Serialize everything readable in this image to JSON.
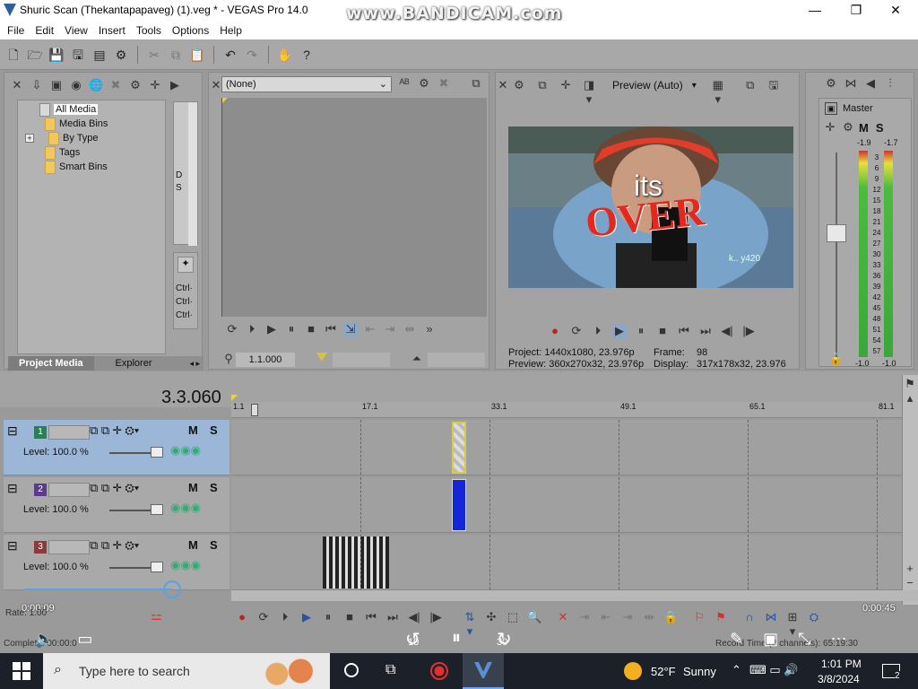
{
  "window": {
    "title": "Shuric Scan (Thekantapapaveg) (1).veg * - VEGAS Pro 14.0",
    "watermark": "www.BANDICAM.com",
    "minimize": "—",
    "maximize": "❐",
    "close": "✕"
  },
  "menu": [
    "File",
    "Edit",
    "View",
    "Insert",
    "Tools",
    "Options",
    "Help"
  ],
  "project_media": {
    "tree": [
      "All Media",
      "Media Bins",
      "By Type",
      "Tags",
      "Smart Bins"
    ],
    "expand": "+",
    "tabs": [
      "Project Media",
      "Explorer"
    ],
    "side_labels": [
      "Ctrl·",
      "Ctrl·",
      "Ctrl·"
    ],
    "side_top": [
      "D",
      "S"
    ]
  },
  "trimmer": {
    "select_value": "(None)",
    "time": "1.1.000"
  },
  "preview": {
    "mode": "Preview (Auto)",
    "overlay_text_1": "its",
    "overlay_text_2": "OVER",
    "overlay_small": "k.. y420",
    "info": {
      "project_label": "Project:",
      "project_value": "1440x1080, 23.976p",
      "preview_label": "Preview:",
      "preview_value": "360x270x32, 23.976p",
      "frame_label": "Frame:",
      "frame_value": "98",
      "display_label": "Display:",
      "display_value": "317x178x32, 23.976"
    }
  },
  "master": {
    "title": "Master",
    "m": "M",
    "s": "S",
    "peak_left": "-1.9",
    "peak_right": "-1.7",
    "scale": [
      "3",
      "6",
      "9",
      "12",
      "15",
      "18",
      "21",
      "24",
      "27",
      "30",
      "33",
      "36",
      "39",
      "42",
      "45",
      "48",
      "51",
      "54",
      "57"
    ],
    "bottom_left": "-1.0",
    "bottom_right": "-1.0"
  },
  "timeline": {
    "time": "3.3.060",
    "ruler": [
      "1.1",
      "17.1",
      "33.1",
      "49.1",
      "65.1",
      "81.1"
    ],
    "tracks": [
      {
        "num": "1",
        "level": "Level: 100.0 %",
        "m": "M",
        "s": "S"
      },
      {
        "num": "2",
        "level": "Level: 100.0 %",
        "m": "M",
        "s": "S"
      },
      {
        "num": "3",
        "level": "Level: 100.0 %",
        "m": "M",
        "s": "S"
      }
    ],
    "rate": "Rate: 1.00",
    "complete": "Complete: 00:00:0",
    "record_time": "Record Time (2 channels): 65:19:30"
  },
  "player": {
    "current": "0:00:09",
    "total": "0:00:45",
    "progress": 0.2,
    "skip_back": "10",
    "skip_fwd": "30"
  },
  "taskbar": {
    "search_placeholder": "Type here to search",
    "temp": "52°F",
    "weather": "Sunny",
    "time": "1:01 PM",
    "date": "3/8/2024",
    "notif_count": "2"
  }
}
